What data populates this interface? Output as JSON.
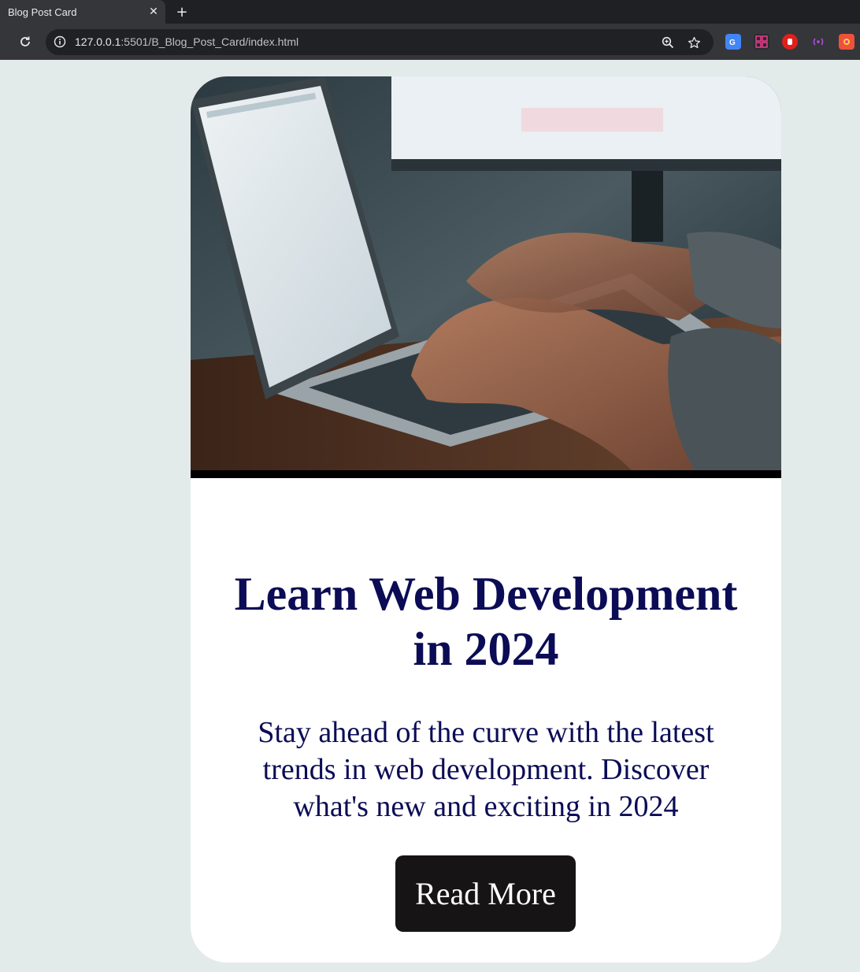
{
  "browser": {
    "tab_title": "Blog Post Card",
    "tab_close": "✕",
    "new_tab": "+",
    "url_host": "127.0.0.1",
    "url_path": ":5501/B_Blog_Post_Card/index.html"
  },
  "card": {
    "image_alt": "Hands typing on a laptop keyboard",
    "title": "Learn Web Development in 2024",
    "description": "Stay ahead of the curve with the latest trends in web development. Discover what's new and exciting in 2024",
    "button_label": "Read More"
  },
  "colors": {
    "page_bg": "#e3eaea",
    "card_bg": "#ffffff",
    "text": "#0b0c55",
    "button_bg": "#161414",
    "button_text": "#ffffff"
  }
}
